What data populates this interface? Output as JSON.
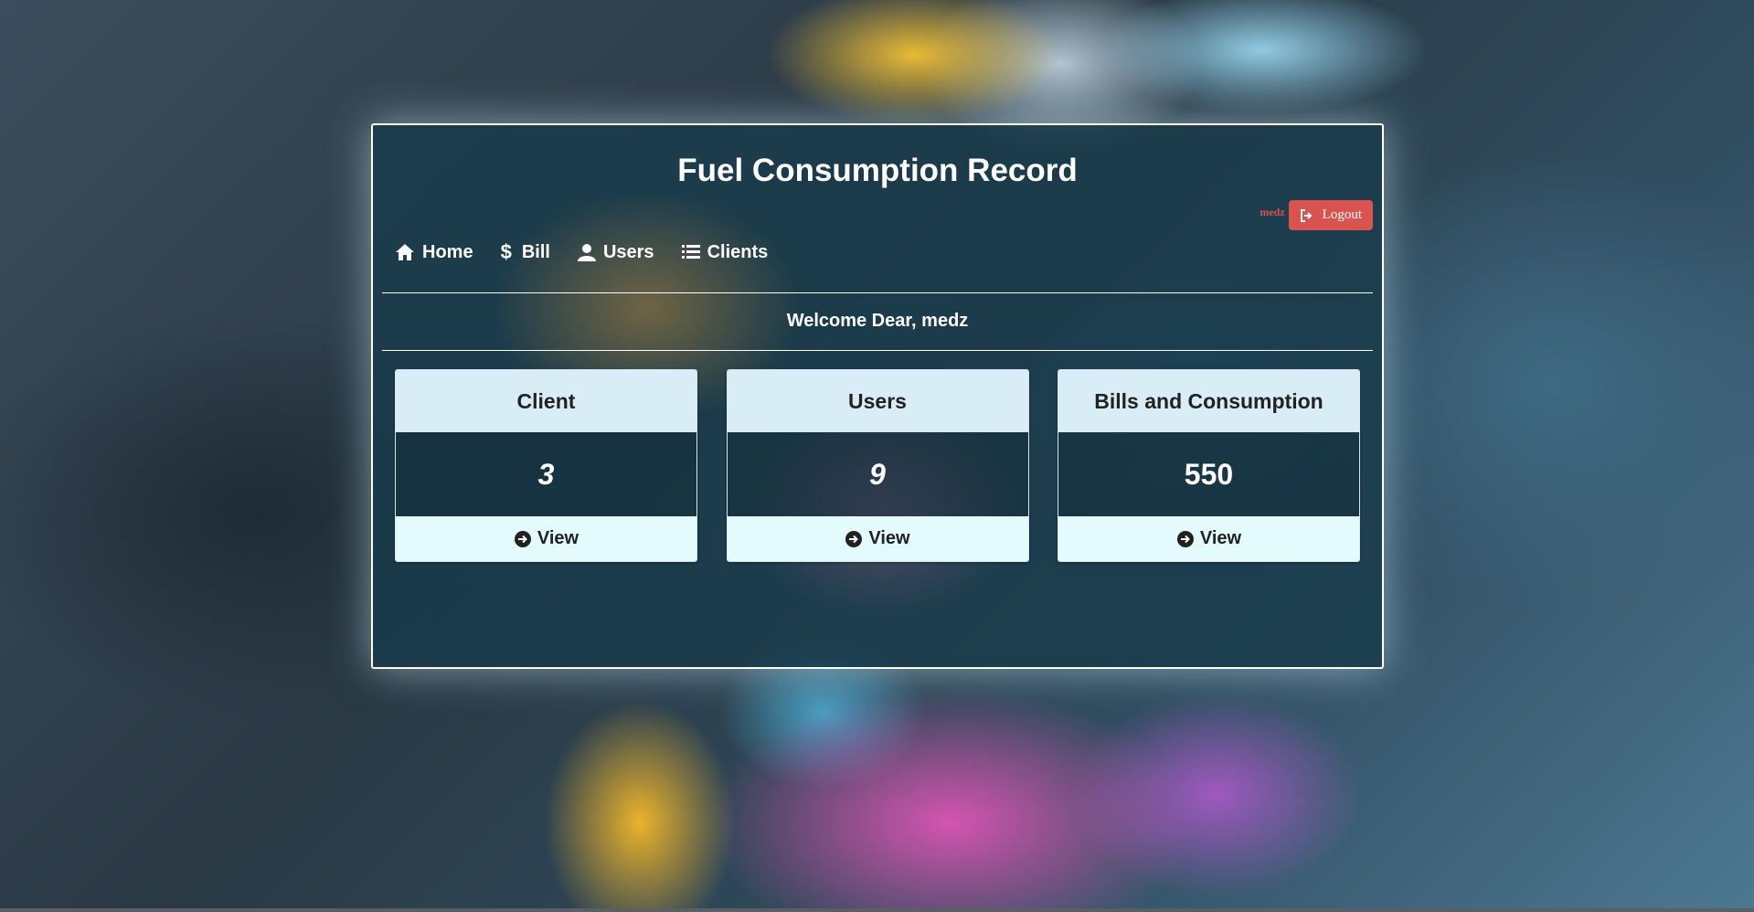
{
  "header": {
    "title": "Fuel Consumption Record",
    "username": "medz",
    "logout_label": "Logout"
  },
  "nav": {
    "items": [
      {
        "label": "Home",
        "icon": "home-icon"
      },
      {
        "label": "Bill",
        "icon": "dollar-icon"
      },
      {
        "label": "Users",
        "icon": "user-icon"
      },
      {
        "label": "Clients",
        "icon": "list-icon"
      }
    ]
  },
  "welcome": "Welcome Dear, medz",
  "cards": [
    {
      "title": "Client",
      "value": "3",
      "action": "View"
    },
    {
      "title": "Users",
      "value": "9",
      "action": "View"
    },
    {
      "title": "Bills and Consumption",
      "value": "550",
      "action": "View"
    }
  ],
  "colors": {
    "danger": "#d9534f",
    "card_header": "#d9edf7",
    "card_footer": "#e4fbfd"
  }
}
